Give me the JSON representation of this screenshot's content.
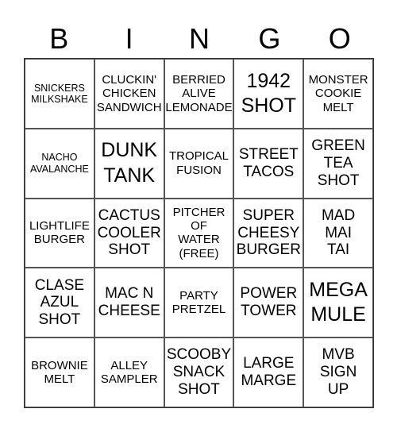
{
  "header": [
    "B",
    "I",
    "N",
    "G",
    "O"
  ],
  "cells": [
    {
      "text": "SNICKERS\nMILKSHAKE",
      "size": "s"
    },
    {
      "text": "CLUCKIN'\nCHICKEN\nSANDWICH",
      "size": "m"
    },
    {
      "text": "BERRIED\nALIVE\nLEMONADE",
      "size": "m"
    },
    {
      "text": "1942\nSHOT",
      "size": "xl"
    },
    {
      "text": "MONSTER\nCOOKIE\nMELT",
      "size": "m"
    },
    {
      "text": "NACHO\nAVALANCHE",
      "size": "s"
    },
    {
      "text": "DUNK\nTANK",
      "size": "xl"
    },
    {
      "text": "TROPICAL\nFUSION",
      "size": "m"
    },
    {
      "text": "STREET\nTACOS",
      "size": "l"
    },
    {
      "text": "GREEN\nTEA\nSHOT",
      "size": "l"
    },
    {
      "text": "LIGHTLIFE\nBURGER",
      "size": "m"
    },
    {
      "text": "CACTUS\nCOOLER\nSHOT",
      "size": "l"
    },
    {
      "text": "PITCHER\nOF\nWATER\n(FREE)",
      "size": "m"
    },
    {
      "text": "SUPER\nCHEESY\nBURGER",
      "size": "l"
    },
    {
      "text": "MAD\nMAI\nTAI",
      "size": "l"
    },
    {
      "text": "CLASE\nAZUL\nSHOT",
      "size": "l"
    },
    {
      "text": "MAC N\nCHEESE",
      "size": "l"
    },
    {
      "text": "PARTY\nPRETZEL",
      "size": "m"
    },
    {
      "text": "POWER\nTOWER",
      "size": "l"
    },
    {
      "text": "MEGA\nMULE",
      "size": "xl"
    },
    {
      "text": "BROWNIE\nMELT",
      "size": "m"
    },
    {
      "text": "ALLEY\nSAMPLER",
      "size": "m"
    },
    {
      "text": "SCOOBY\nSNACK\nSHOT",
      "size": "l"
    },
    {
      "text": "LARGE\nMARGE",
      "size": "l"
    },
    {
      "text": "MVB\nSIGN\nUP",
      "size": "l"
    }
  ]
}
